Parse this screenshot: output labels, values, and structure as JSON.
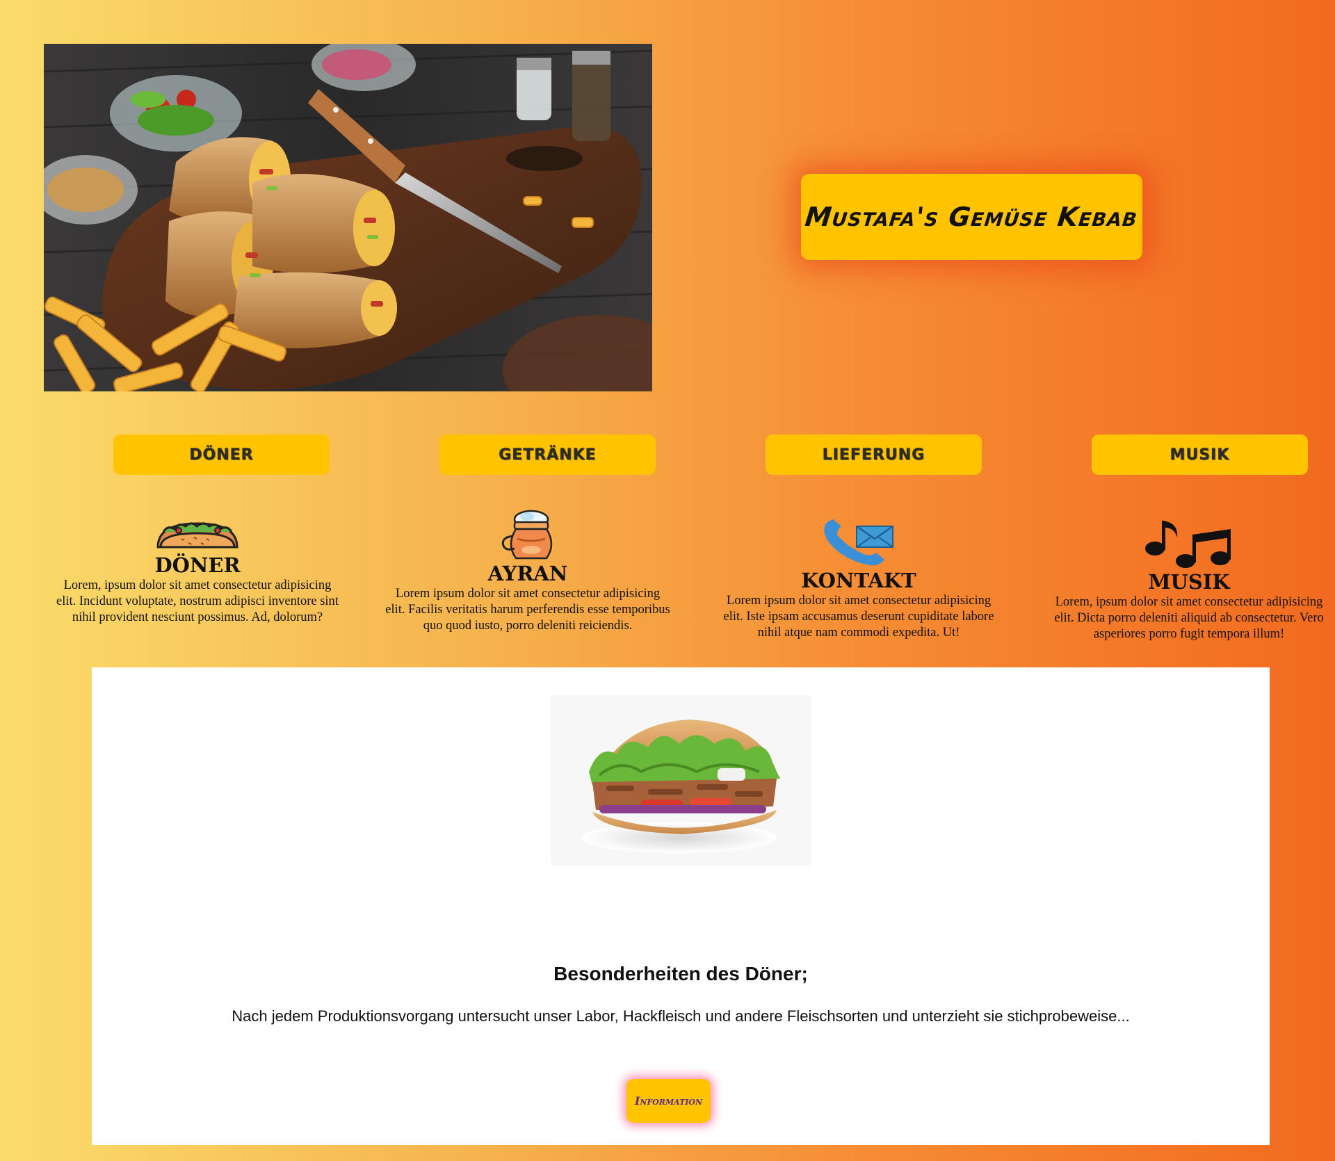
{
  "header": {
    "title": "Mustafa's Gemüse Kebab",
    "hero_image_alt": "Dürüm wraps with fries and salad on a wooden board"
  },
  "nav": {
    "items": [
      {
        "label": "DÖNER"
      },
      {
        "label": "GETRÄNKE"
      },
      {
        "label": "LIEFERUNG"
      },
      {
        "label": "MUSIK"
      }
    ]
  },
  "features": [
    {
      "icon": "taco-icon",
      "title": "DÖNER",
      "text": "Lorem, ipsum dolor sit amet consectetur adipisicing elit. Incidunt voluptate, nostrum adipisci inventore sint nihil provident nesciunt possimus. Ad, dolorum?"
    },
    {
      "icon": "ayran-jug-icon",
      "title": "AYRAN",
      "text": "Lorem ipsum dolor sit amet consectetur adipisicing elit. Facilis veritatis harum perferendis esse temporibus quo quod iusto, porro deleniti reiciendis."
    },
    {
      "icon": "phone-mail-icon",
      "title": "KONTAKT",
      "text": "Lorem ipsum dolor sit amet consectetur adipisicing elit. Iste ipsam accusamus deserunt cupiditate labore nihil atque nam commodi expedita. Ut!"
    },
    {
      "icon": "music-notes-icon",
      "title": "MUSIK",
      "text": "Lorem, ipsum dolor sit amet consectetur adipisicing elit. Dicta porro deleniti aliquid ab consectetur. Vero asperiores porro fugit tempora illum!"
    }
  ],
  "panel": {
    "heading": "Besonderheiten des Döner;",
    "text": "Nach jedem Produktionsvorgang untersucht unser Labor, Hackfleisch und andere Fleischsorten und unterzieht sie stichprobeweise...",
    "button_label": "Information"
  },
  "colors": {
    "accent": "#ffc300",
    "gradient_start": "#fbdc6b",
    "gradient_end": "#f26a1f",
    "title_glow": "#e83c14",
    "info_glow": "#f0508c"
  }
}
